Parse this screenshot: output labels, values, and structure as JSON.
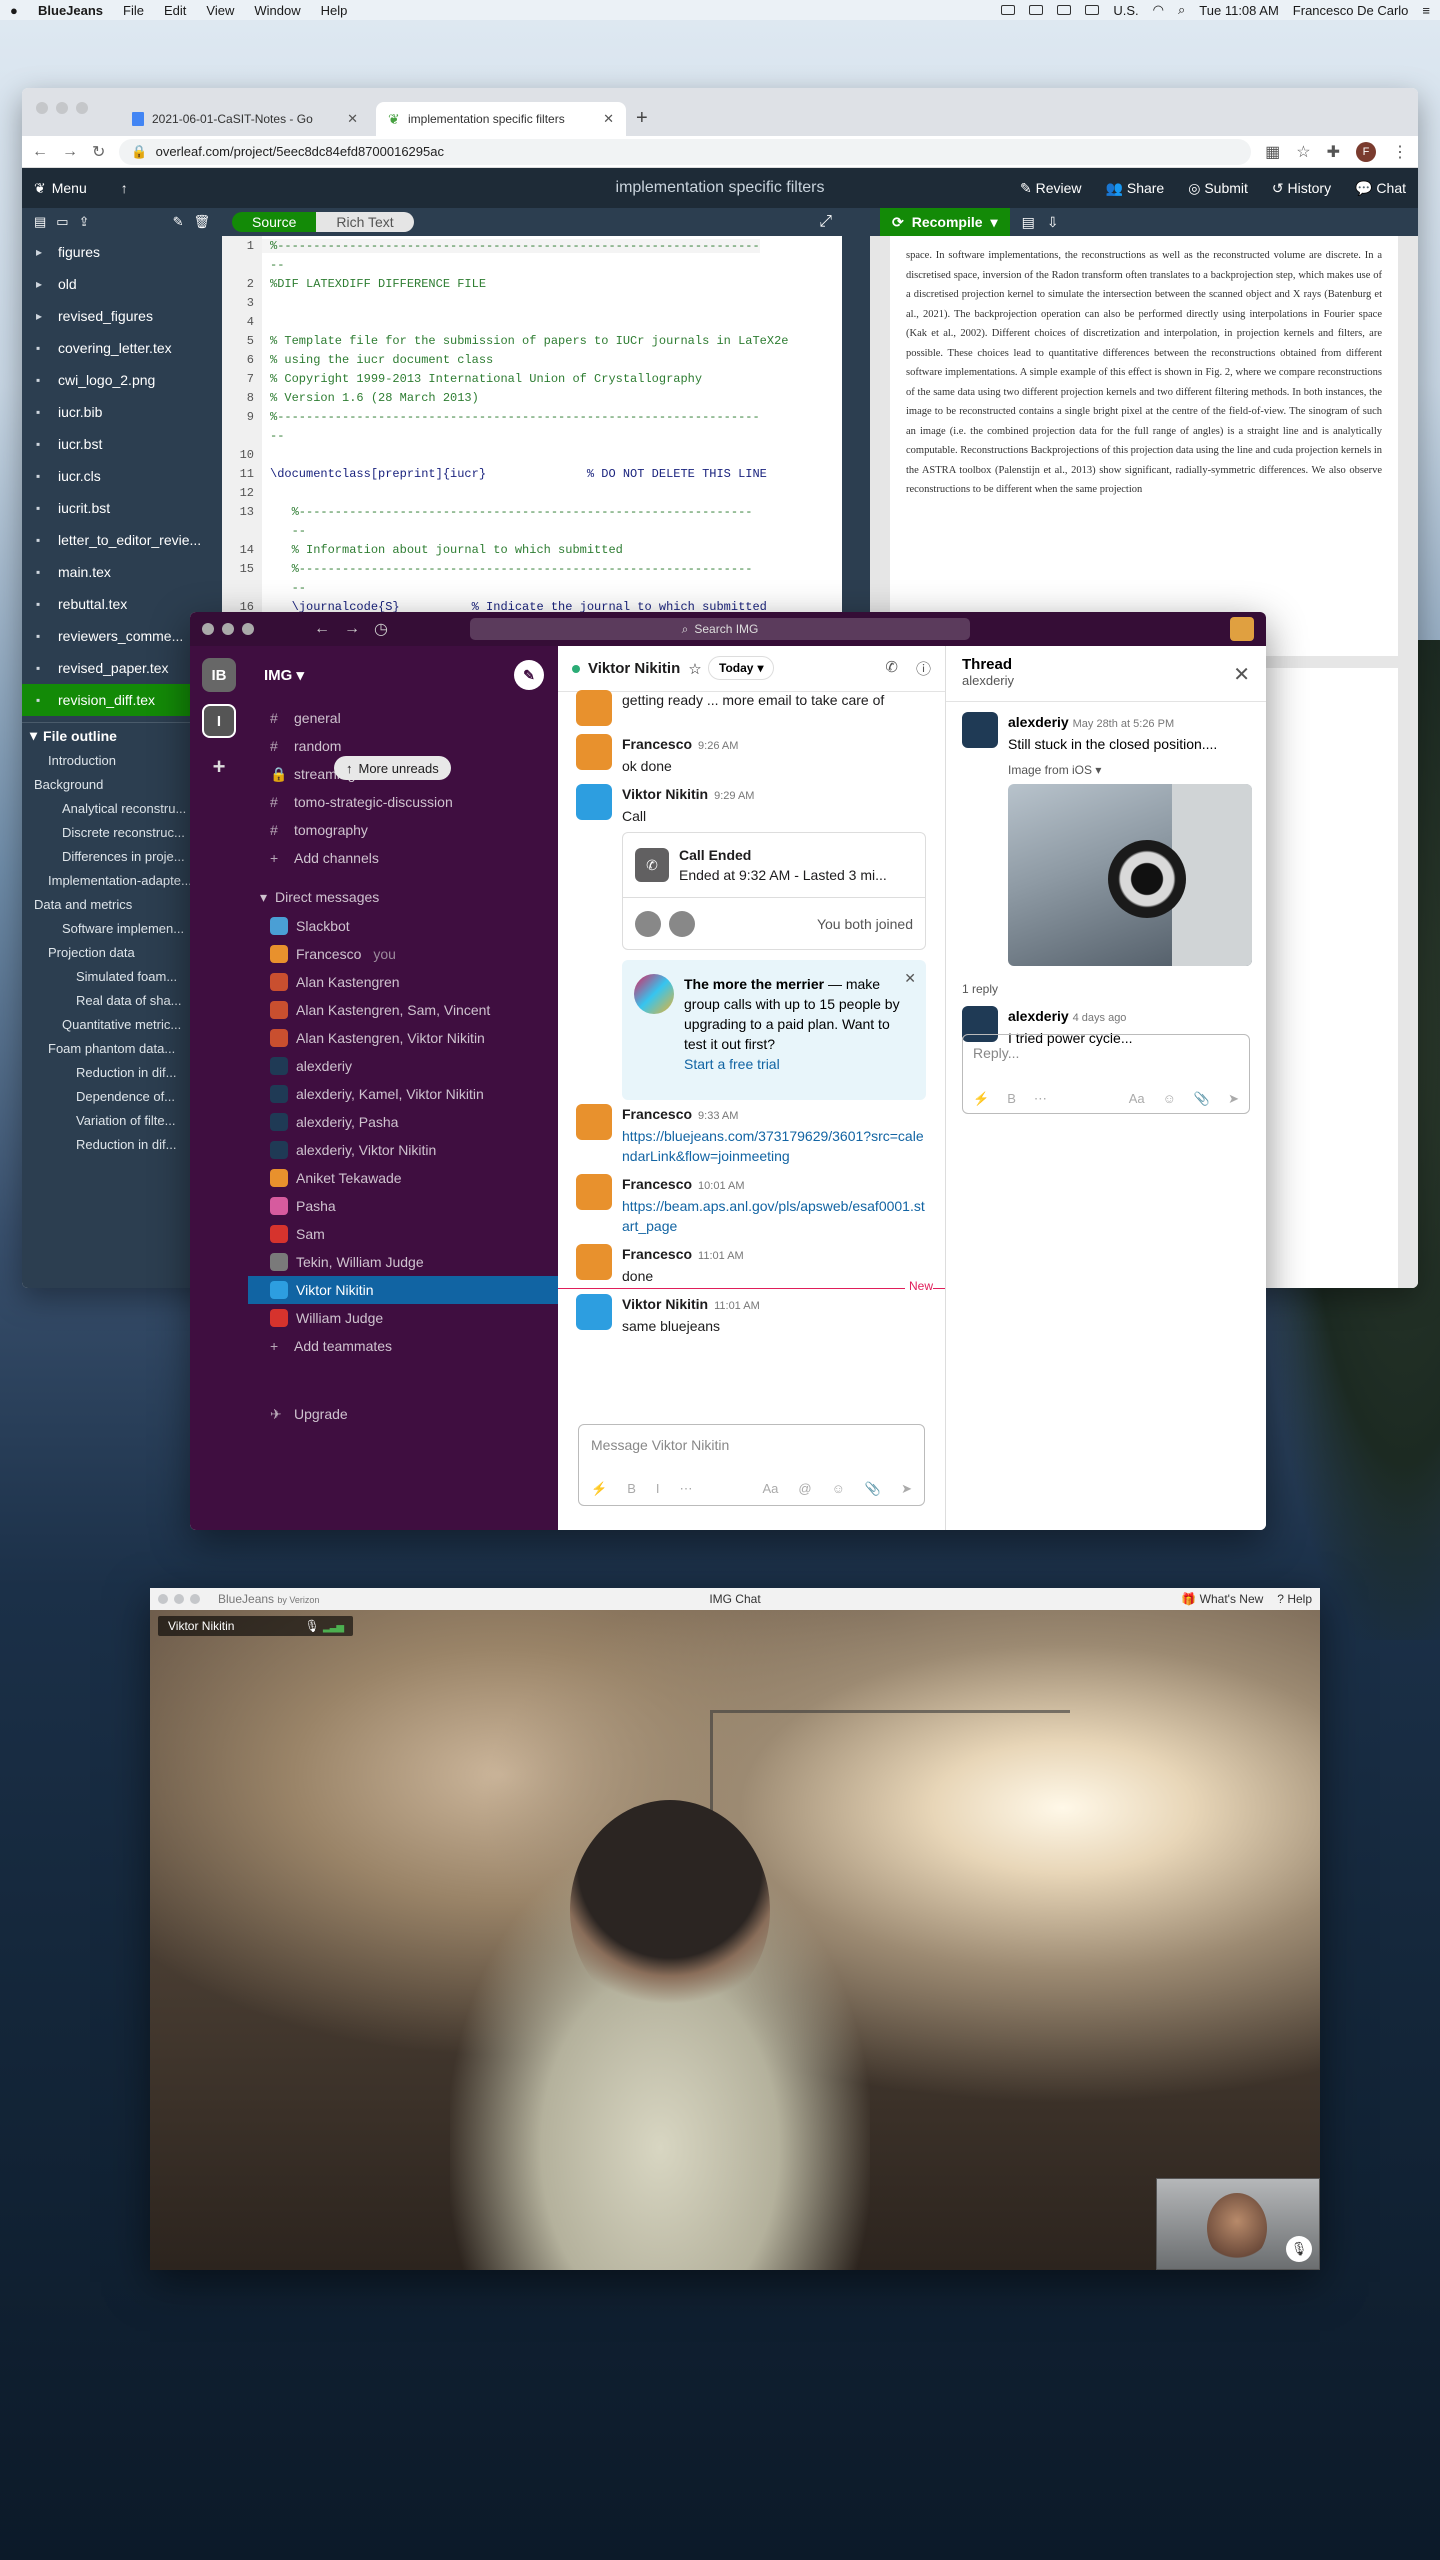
{
  "menubar": {
    "apple": "",
    "app": "BlueJeans",
    "items": [
      "File",
      "Edit",
      "View",
      "Window",
      "Help"
    ],
    "locale": "U.S.",
    "clock": "Tue 11:08 AM",
    "user": "Francesco De Carlo"
  },
  "chrome": {
    "tabs": [
      {
        "title": "2021-06-01-CaSIT-Notes - Go"
      },
      {
        "title": "implementation specific filters"
      }
    ],
    "url": "overleaf.com/project/5eec8dc84efd8700016295ac",
    "profile_initial": "F"
  },
  "overleaf": {
    "menu_label": "Menu",
    "project_title": "implementation specific filters",
    "actions": [
      "Review",
      "Share",
      "Submit",
      "History",
      "Chat"
    ],
    "source_label": "Source",
    "richtext_label": "Rich Text",
    "recompile_label": "Recompile",
    "files": [
      {
        "name": "figures",
        "type": "folder"
      },
      {
        "name": "old",
        "type": "folder"
      },
      {
        "name": "revised_figures",
        "type": "folder"
      },
      {
        "name": "covering_letter.tex",
        "type": "file"
      },
      {
        "name": "cwi_logo_2.png",
        "type": "image"
      },
      {
        "name": "iucr.bib",
        "type": "file"
      },
      {
        "name": "iucr.bst",
        "type": "file"
      },
      {
        "name": "iucr.cls",
        "type": "file"
      },
      {
        "name": "iucrit.bst",
        "type": "file"
      },
      {
        "name": "letter_to_editor_revie...",
        "type": "file"
      },
      {
        "name": "main.tex",
        "type": "file"
      },
      {
        "name": "rebuttal.tex",
        "type": "file"
      },
      {
        "name": "reviewers_comme...",
        "type": "file"
      },
      {
        "name": "revised_paper.tex",
        "type": "file"
      },
      {
        "name": "revision_diff.tex",
        "type": "file",
        "selected": true
      }
    ],
    "outline_title": "File outline",
    "outline": [
      {
        "label": "Introduction",
        "level": 1
      },
      {
        "label": "Background",
        "level": 0
      },
      {
        "label": "Analytical reconstru...",
        "level": 2
      },
      {
        "label": "Discrete reconstruc...",
        "level": 2
      },
      {
        "label": "Differences in proje...",
        "level": 2
      },
      {
        "label": "Implementation-adapte...",
        "level": 1
      },
      {
        "label": "Data and metrics",
        "level": 0
      },
      {
        "label": "Software implemen...",
        "level": 2
      },
      {
        "label": "Projection data",
        "level": 1
      },
      {
        "label": "Simulated foam...",
        "level": 3
      },
      {
        "label": "Real data of sha...",
        "level": 3
      },
      {
        "label": "Quantitative metric...",
        "level": 2
      },
      {
        "label": "Foam phantom data...",
        "level": 1
      },
      {
        "label": "Reduction in dif...",
        "level": 3
      },
      {
        "label": "Dependence of...",
        "level": 3
      },
      {
        "label": "Variation of filte...",
        "level": 3
      },
      {
        "label": "Reduction in dif...",
        "level": 3
      }
    ],
    "code_lines": [
      {
        "n": "1",
        "text": "%-------------------------------------------------------------------",
        "cls": "",
        "cur": true
      },
      {
        "n": "",
        "text": "--",
        "cls": ""
      },
      {
        "n": "2",
        "text": "%DIF LATEXDIFF DIFFERENCE FILE",
        "cls": ""
      },
      {
        "n": "3",
        "text": "",
        "cls": ""
      },
      {
        "n": "4",
        "text": "",
        "cls": ""
      },
      {
        "n": "5",
        "text": "% Template file for the submission of papers to IUCr journals in LaTeX2e",
        "cls": ""
      },
      {
        "n": "6",
        "text": "% using the iucr document class",
        "cls": ""
      },
      {
        "n": "7",
        "text": "% Copyright 1999-2013 International Union of Crystallography",
        "cls": ""
      },
      {
        "n": "8",
        "text": "% Version 1.6 (28 March 2013)",
        "cls": ""
      },
      {
        "n": "9",
        "text": "%-------------------------------------------------------------------",
        "cls": ""
      },
      {
        "n": "",
        "text": "--",
        "cls": ""
      },
      {
        "n": "10",
        "text": "",
        "cls": ""
      },
      {
        "n": "11",
        "text": "\\documentclass[preprint]{iucr}              % DO NOT DELETE THIS LINE",
        "cls": "k"
      },
      {
        "n": "12",
        "text": "",
        "cls": ""
      },
      {
        "n": "13",
        "text": "   %---------------------------------------------------------------",
        "cls": ""
      },
      {
        "n": "",
        "text": "   --",
        "cls": ""
      },
      {
        "n": "14",
        "text": "   % Information about journal to which submitted",
        "cls": ""
      },
      {
        "n": "15",
        "text": "   %---------------------------------------------------------------",
        "cls": ""
      },
      {
        "n": "",
        "text": "   --",
        "cls": ""
      },
      {
        "n": "16",
        "text": "   \\journalcode{S}          % Indicate the journal to which submitted",
        "cls": "k"
      }
    ],
    "pdf_text": "space. In software implementations, the reconstructions as well as the reconstructed volume are discrete. In a discretised space, inversion of the Radon transform often translates to a backprojection step, which makes use of a discretised projection kernel to simulate the intersection between the scanned object and X rays (Batenburg et al., 2021). The backprojection operation can also be performed directly using interpolations in Fourier space (Kak et al., 2002). Different choices of discretization and interpolation, in projection kernels and filters, are possible. These choices lead to quantitative differences between the reconstructions obtained from different software implementations. A simple example of this effect is shown in Fig. 2, where we compare reconstructions of the same data using two different projection kernels and two different filtering methods. In both instances, the image to be reconstructed contains a single bright pixel at the centre of the field-of-view. The sinogram of such an image (i.e. the combined projection data for the full range of angles) is a straight line and is analytically computable. Reconstructions Backprojections of this projection data using the line and cuda projection kernels in the ASTRA toolbox (Palenstijn et al., 2013) show significant, radially-symmetric differences. We also observe reconstructions to be different when the same projection"
  },
  "slack": {
    "search_placeholder": "Search IMG",
    "workspace_initials": "IB",
    "workspace_active": "I",
    "workspace_name": "IMG",
    "more_unreads": "More unreads",
    "channels": [
      "general",
      "random",
      "streaming",
      "tomo-strategic-discussion",
      "tomography"
    ],
    "add_channels": "Add channels",
    "dm_header": "Direct messages",
    "dms": [
      {
        "name": "Slackbot",
        "color": "#4a9fd5"
      },
      {
        "name": "Francesco",
        "you": "you",
        "color": "#e8912d"
      },
      {
        "name": "Alan Kastengren",
        "color": "#c94f2f"
      },
      {
        "name": "Alan Kastengren, Sam, Vincent",
        "color": "#c94f2f"
      },
      {
        "name": "Alan Kastengren, Viktor Nikitin",
        "color": "#c94f2f"
      },
      {
        "name": "alexderiy",
        "color": "#1f3a55"
      },
      {
        "name": "alexderiy, Kamel, Viktor Nikitin",
        "color": "#1f3a55"
      },
      {
        "name": "alexderiy, Pasha",
        "color": "#1f3a55"
      },
      {
        "name": "alexderiy, Viktor Nikitin",
        "color": "#1f3a55"
      },
      {
        "name": "Aniket Tekawade",
        "color": "#e8912d"
      },
      {
        "name": "Pasha",
        "color": "#d65b9e"
      },
      {
        "name": "Sam",
        "color": "#d6332d"
      },
      {
        "name": "Tekin, William Judge",
        "color": "#7a7a7a"
      },
      {
        "name": "Viktor Nikitin",
        "color": "#2d9ee0",
        "selected": true
      },
      {
        "name": "William Judge",
        "color": "#d6332d"
      }
    ],
    "add_teammates": "Add teammates",
    "upgrade": "Upgrade",
    "channel_name": "Viktor Nikitin",
    "today": "Today",
    "messages": [
      {
        "who": "",
        "time": "",
        "text": "getting ready ... more email to take care of",
        "avatar": "#e8912d"
      },
      {
        "who": "Francesco",
        "time": "9:26 AM",
        "text": "ok done",
        "avatar": "#e8912d"
      },
      {
        "who": "Viktor Nikitin",
        "time": "9:29 AM",
        "text": "Call",
        "avatar": "#2d9ee0"
      }
    ],
    "call_card": {
      "title": "Call Ended",
      "detail": "Ended at 9:32 AM - Lasted 3 mi...",
      "joined": "You both joined"
    },
    "promo": {
      "bold": "The more the merrier",
      "text": " — make group calls with up to 15 people by upgrading to a paid plan. Want to test it out first?",
      "link": "Start a free trial"
    },
    "messages2": [
      {
        "who": "Francesco",
        "time": "9:33 AM",
        "text": "https://bluejeans.com/373179629/3601?src=calendarLink&flow=joinmeeting",
        "link": true,
        "avatar": "#e8912d"
      },
      {
        "who": "Francesco",
        "time": "10:01 AM",
        "text": "https://beam.aps.anl.gov/pls/apsweb/esaf0001.start_page",
        "link": true,
        "avatar": "#e8912d"
      },
      {
        "who": "Francesco",
        "time": "11:01 AM",
        "text": "done",
        "avatar": "#e8912d"
      },
      {
        "who": "Viktor Nikitin",
        "time": "11:01 AM",
        "text": "same bluejeans",
        "avatar": "#2d9ee0"
      }
    ],
    "new_label": "New",
    "composer_placeholder": "Message Viktor Nikitin",
    "thread": {
      "title": "Thread",
      "subtitle": "alexderiy",
      "author": "alexderiy",
      "time": "May 28th at 5:26 PM",
      "text": "Still stuck in the closed position....",
      "image_label": "Image from iOS",
      "replies": "1 reply",
      "reply_author": "alexderiy",
      "reply_time": "4 days ago",
      "reply_text": "I tried power cycle...",
      "reply_placeholder": "Reply..."
    }
  },
  "bluejeans": {
    "brand": "BlueJeans",
    "by": "by Verizon",
    "title": "IMG Chat",
    "whats_new": "What's New",
    "help": "Help",
    "participant": "Viktor Nikitin"
  }
}
